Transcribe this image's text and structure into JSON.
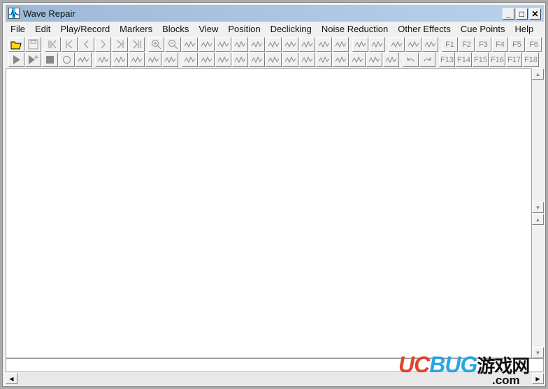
{
  "window": {
    "title": "Wave Repair",
    "minimize": "_",
    "maximize": "□",
    "close": "✕"
  },
  "menu": [
    "File",
    "Edit",
    "Play/Record",
    "Markers",
    "Blocks",
    "View",
    "Position",
    "Declicking",
    "Noise Reduction",
    "Other Effects",
    "Cue Points",
    "Help"
  ],
  "toolbar_row1": {
    "groups": [
      [
        "open-folder",
        "save"
      ],
      [
        "go-start",
        "go-prev-marker",
        "scroll-left",
        "scroll-right",
        "go-next-marker",
        "go-end"
      ],
      [
        "zoom-in",
        "zoom-out",
        "zoom-wave",
        "wave",
        "wave-mark-left",
        "wave-mark-right",
        "wave-range",
        "wave-spectrum",
        "range-horizontal",
        "range-vertical",
        "wave-cut-left",
        "wave-cut-right"
      ],
      [
        "wave-list",
        "wave-list-2"
      ],
      [
        "wave-add",
        "wave-split",
        "wave-arrow"
      ]
    ],
    "function_keys": [
      "F1",
      "F2",
      "F3",
      "F4",
      "F5",
      "F6"
    ]
  },
  "toolbar_row2": {
    "groups": [
      [
        "play",
        "play-add",
        "stop",
        "record",
        "channels"
      ],
      [
        "block-line-1",
        "block-line-2",
        "block-line-3",
        "block-line-4",
        "block-wave"
      ],
      [
        "wave-zoom-2",
        "wave-step",
        "wave-step-2",
        "wave-loop",
        "wave-loop-left",
        "wave-loop-right",
        "wave-comment",
        "wave-search",
        "wave-click",
        "wave-declick",
        "wave-click-arrow",
        "wave-click-marker",
        "wave-noise"
      ],
      [
        "undo",
        "redo"
      ]
    ],
    "function_keys": [
      "F13",
      "F14",
      "F15",
      "F16",
      "F17",
      "F18"
    ]
  },
  "watermark": {
    "brand_a": "UC",
    "brand_b": "BUG",
    "brand_cn": "游戏网",
    "domain": ".com"
  }
}
